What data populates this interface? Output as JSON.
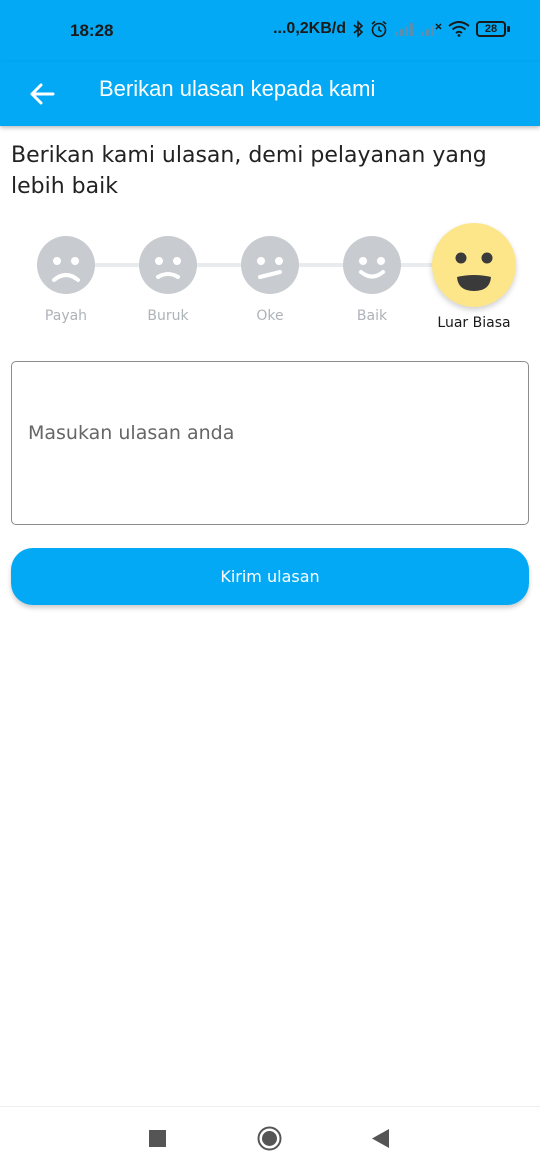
{
  "status_bar": {
    "time": "18:28",
    "network_speed": "...0,2KB/d",
    "battery_level": "28",
    "icons": [
      "bluetooth-icon",
      "alarm-icon",
      "signal-icon",
      "signal-x-icon",
      "wifi-icon",
      "battery-icon"
    ]
  },
  "app_bar": {
    "title": "Berikan ulasan kepada kami",
    "back_icon": "arrow-left-icon"
  },
  "prompt": "Berikan kami ulasan, demi pelayanan yang lebih baik",
  "rating": {
    "selected": "Luar Biasa",
    "options": [
      {
        "label": "Payah",
        "icon": "very-sad-face-icon"
      },
      {
        "label": "Buruk",
        "icon": "sad-face-icon"
      },
      {
        "label": "Oke",
        "icon": "neutral-face-icon"
      },
      {
        "label": "Baik",
        "icon": "happy-face-icon"
      },
      {
        "label": "Luar Biasa",
        "icon": "excellent-face-icon"
      }
    ],
    "colors": {
      "inactive": "#c8ccd1",
      "active": "#fde58a"
    }
  },
  "review": {
    "placeholder": "Masukan ulasan anda",
    "value": ""
  },
  "submit_label": "Kirim ulasan",
  "colors": {
    "primary": "#03a9f4"
  },
  "nav_bar": {
    "icons": [
      "recents-square-icon",
      "home-circle-icon",
      "back-triangle-icon"
    ]
  }
}
